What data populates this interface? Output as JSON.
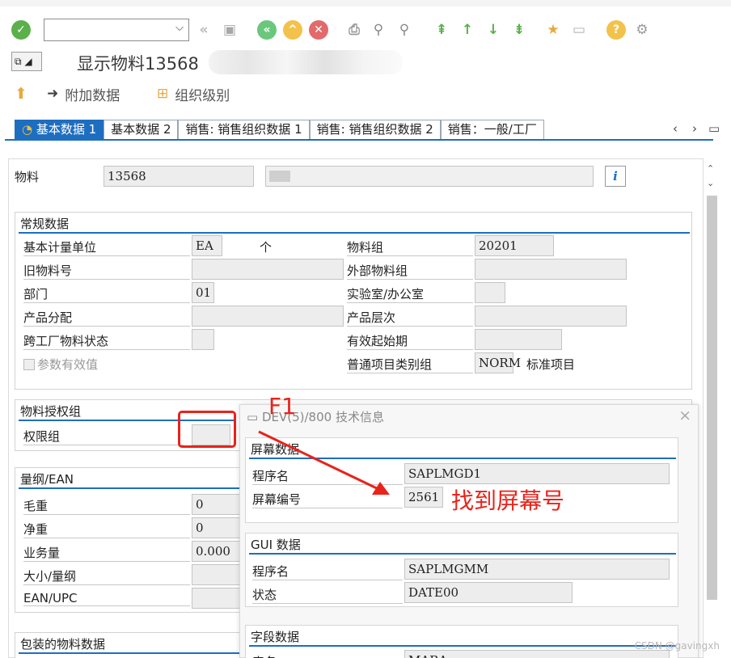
{
  "toolbar": {
    "command_field_value": "",
    "icons": [
      "enter-icon",
      "back-icon",
      "save-icon",
      "green-back-icon",
      "exit-icon",
      "cancel-icon",
      "print-icon",
      "find-icon",
      "find-next-icon",
      "first-page-icon",
      "prev-page-icon",
      "next-page-icon",
      "last-page-icon",
      "create-session-icon",
      "shortcut-icon",
      "help-icon",
      "settings-icon"
    ]
  },
  "title": {
    "text": "显示物料13568"
  },
  "app_toolbar": {
    "additional_data": "附加数据",
    "org_levels": "组织级别"
  },
  "tabs": [
    {
      "label": "基本数据 1"
    },
    {
      "label": "基本数据 2"
    },
    {
      "label": "销售: 销售组织数据 1"
    },
    {
      "label": "销售: 销售组织数据 2"
    },
    {
      "label": "销售：一般/工厂"
    }
  ],
  "material": {
    "label": "物料",
    "value": "13568",
    "info_icon": "i"
  },
  "general": {
    "title": "常规数据",
    "base_uom_label": "基本计量单位",
    "base_uom_value": "EA",
    "base_uom_text": "个",
    "material_group_label": "物料组",
    "material_group_value": "20201",
    "old_material_label": "旧物料号",
    "ext_material_group_label": "外部物料组",
    "division_label": "部门",
    "division_value": "01",
    "lab_office_label": "实验室/办公室",
    "product_alloc_label": "产品分配",
    "product_hierarchy_label": "产品层次",
    "cross_plant_status_label": "跨工厂物料状态",
    "valid_from_label": "有效起始期",
    "param_effectivity_label": "参数有效值",
    "item_cat_group_label": "普通项目类别组",
    "item_cat_group_value": "NORM",
    "item_cat_group_text": "标准项目"
  },
  "auth": {
    "title": "物料授权组",
    "auth_group_label": "权限组"
  },
  "dims": {
    "title": "量纲/EAN",
    "gross_weight_label": "毛重",
    "gross_weight_value": "0",
    "net_weight_label": "净重",
    "net_weight_value": "0",
    "volume_label": "业务量",
    "volume_value": "0.000",
    "size_label": "大小/量纲",
    "ean_label": "EAN/UPC"
  },
  "packaging": {
    "title": "包装的物料数据"
  },
  "popup": {
    "title": "DEV(5)/800 技术信息",
    "screen_data_title": "屏幕数据",
    "program_label": "程序名",
    "program_value": "SAPLMGD1",
    "screen_no_label": "屏幕编号",
    "screen_no_value": "2561",
    "gui_data_title": "GUI 数据",
    "gui_program_label": "程序名",
    "gui_program_value": "SAPLMGMM",
    "status_label": "状态",
    "status_value": "DATE00",
    "field_data_title": "字段数据",
    "table_label": "表名",
    "table_value": "MARA"
  },
  "annotations": {
    "f1_label": "F1",
    "find_screen_label": "找到屏幕号",
    "color": "#e8231b"
  },
  "watermark": "CSDN @gavingxh"
}
